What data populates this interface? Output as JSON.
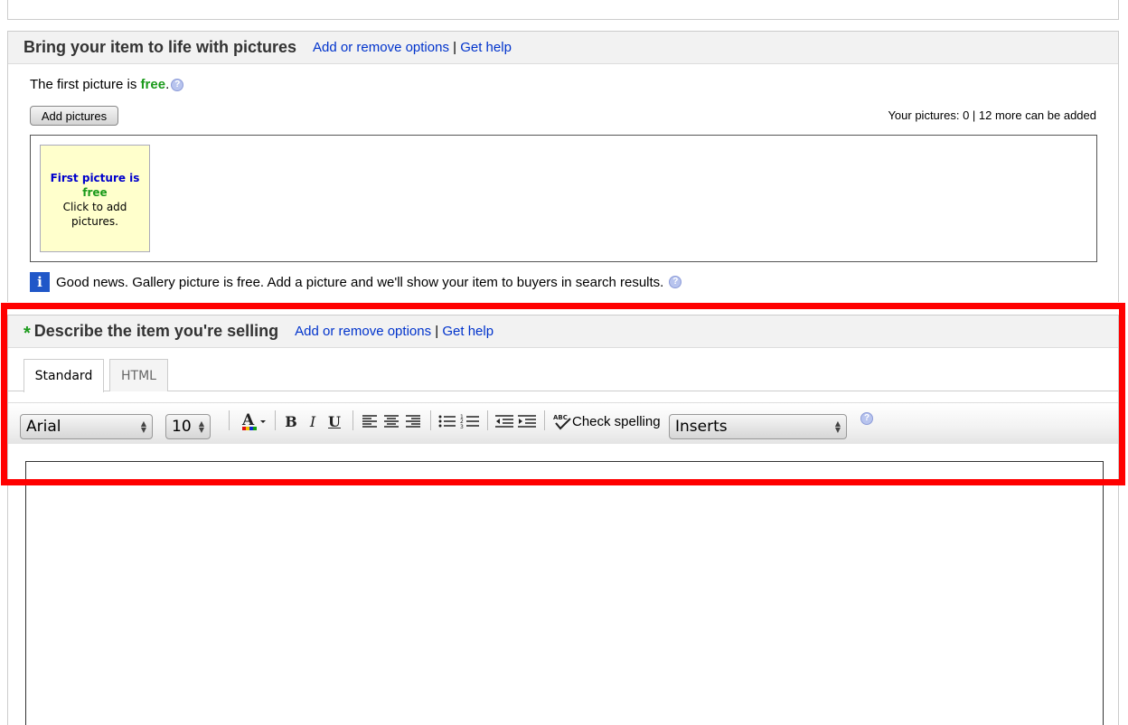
{
  "pictures_section": {
    "title": "Bring your item to life with pictures",
    "add_remove_link": "Add or remove options",
    "separator": "|",
    "help_link": "Get help",
    "first_picture_text": "The first picture is ",
    "first_picture_free": "free",
    "period": ".",
    "add_button": "Add pictures",
    "your_pictures": "Your pictures: 0 | 12 more can be added",
    "slot_line1": "First picture is",
    "slot_line2": "free",
    "slot_line3": "Click to add",
    "slot_line4": "pictures.",
    "gallery_text": "Good news. Gallery picture is free. Add a picture and we'll show your item to buyers in search results."
  },
  "describe_section": {
    "required_mark": "*",
    "title": "Describe the item you're selling",
    "add_remove_link": "Add or remove options",
    "separator": "|",
    "help_link": "Get help",
    "tabs": [
      {
        "label": "Standard",
        "active": true
      },
      {
        "label": "HTML",
        "active": false
      }
    ],
    "toolbar": {
      "font": "Arial",
      "size": "10",
      "bold": "B",
      "italic": "I",
      "underline": "U",
      "check_spelling": "Check spelling",
      "inserts": "Inserts"
    }
  },
  "icons": {
    "help": "help-circle-icon",
    "info": "info-icon",
    "font_color": "font-color-icon",
    "spellcheck": "spellcheck-icon"
  },
  "colors": {
    "link": "#0033cc",
    "free_green": "#1a9a1a",
    "highlight": "#ff0000"
  }
}
